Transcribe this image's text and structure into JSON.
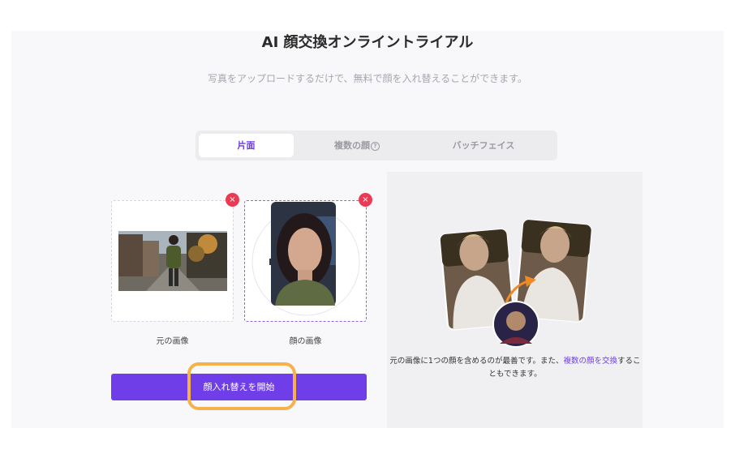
{
  "header": {
    "title": "AI 顔交換オンライントライアル",
    "subtitle": "写真をアップロードするだけで、無料で顔を入れ替えることができます。"
  },
  "tabs": [
    {
      "label": "片面",
      "active": true
    },
    {
      "label": "複数の顔",
      "help_icon": "?",
      "active": false
    },
    {
      "label": "バッチフェイス",
      "active": false
    }
  ],
  "uploads": {
    "source": {
      "caption": "元の画像",
      "remove_icon": "×"
    },
    "face": {
      "caption": "顔の画像",
      "remove_icon": "×"
    }
  },
  "start_button": {
    "label": "顔入れ替えを開始"
  },
  "example": {
    "tip_before": "元の画像に1つの顔を含めるのが最善です。また、",
    "tip_link": "複数の顔を交換",
    "tip_after": "することもできます。"
  },
  "colors": {
    "accent": "#6f3ee8",
    "remove": "#ec3a55",
    "highlight": "#f7b14a"
  }
}
